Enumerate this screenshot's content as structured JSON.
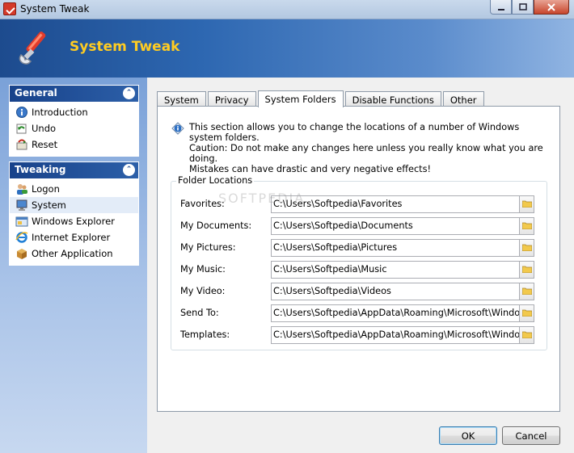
{
  "window": {
    "title": "System Tweak"
  },
  "header": {
    "title": "System Tweak"
  },
  "sidebar": {
    "groups": [
      {
        "title": "General",
        "items": [
          {
            "label": "Introduction",
            "icon": "info-icon"
          },
          {
            "label": "Undo",
            "icon": "undo-icon"
          },
          {
            "label": "Reset",
            "icon": "reset-icon"
          }
        ]
      },
      {
        "title": "Tweaking",
        "items": [
          {
            "label": "Logon",
            "icon": "users-icon"
          },
          {
            "label": "System",
            "icon": "computer-icon"
          },
          {
            "label": "Windows Explorer",
            "icon": "explorer-icon"
          },
          {
            "label": "Internet Explorer",
            "icon": "ie-icon"
          },
          {
            "label": "Other Application",
            "icon": "box-icon"
          }
        ]
      }
    ]
  },
  "tabs": [
    "System",
    "Privacy",
    "System Folders",
    "Disable Functions",
    "Other"
  ],
  "active_tab": "System Folders",
  "info": {
    "line1": "This section allows you to change the locations of a number of Windows system folders.",
    "line2": "Caution: Do not make any changes here unless you really know what you are doing.",
    "line3": "Mistakes can have drastic and very negative effects!"
  },
  "folders": {
    "legend": "Folder Locations",
    "rows": [
      {
        "label": "Favorites:",
        "value": "C:\\Users\\Softpedia\\Favorites"
      },
      {
        "label": "My Documents:",
        "value": "C:\\Users\\Softpedia\\Documents"
      },
      {
        "label": "My Pictures:",
        "value": "C:\\Users\\Softpedia\\Pictures"
      },
      {
        "label": "My Music:",
        "value": "C:\\Users\\Softpedia\\Music"
      },
      {
        "label": "My Video:",
        "value": "C:\\Users\\Softpedia\\Videos"
      },
      {
        "label": "Send To:",
        "value": "C:\\Users\\Softpedia\\AppData\\Roaming\\Microsoft\\Windows\\SendTo"
      },
      {
        "label": "Templates:",
        "value": "C:\\Users\\Softpedia\\AppData\\Roaming\\Microsoft\\Windows\\Templates"
      }
    ]
  },
  "buttons": {
    "ok": "OK",
    "cancel": "Cancel"
  },
  "watermark": "SOFTPEDIA",
  "colors": {
    "header_title": "#ffcc22",
    "group_header": "#18428a"
  }
}
